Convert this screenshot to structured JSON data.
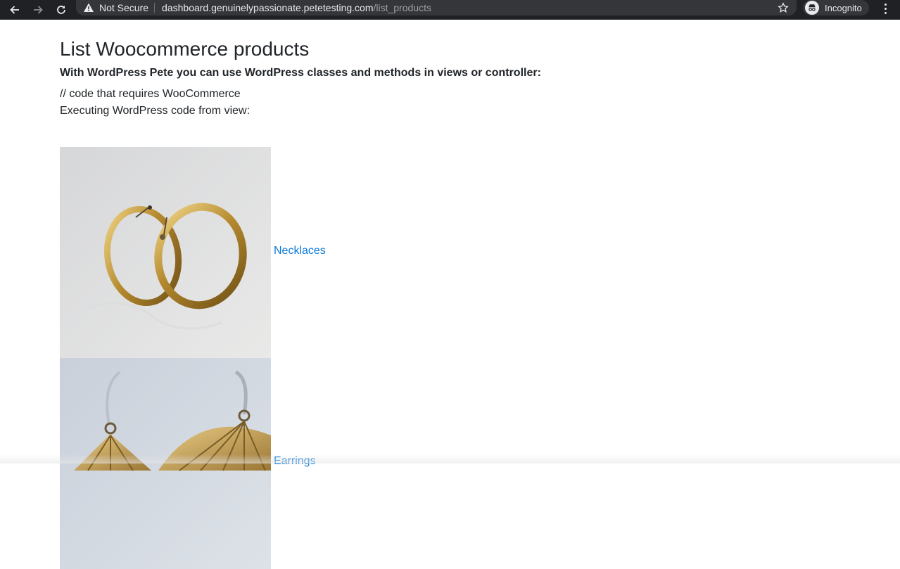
{
  "browser": {
    "security_label": "Not Secure",
    "url_host": "dashboard.genuinelypassionate.petetesting.com",
    "url_path": "/list_products",
    "profile_label": "Incognito"
  },
  "page": {
    "title": "List Woocommerce products",
    "subtitle": "With WordPress Pete you can use WordPress classes and methods in views or controller:",
    "code_comment": "// code that requires WooCommerce",
    "executing_note": "Executing WordPress code from view:"
  },
  "products": [
    {
      "category": "Necklaces",
      "image": "gold-hoop-earrings-photo"
    },
    {
      "category": "Earrings",
      "image": "gold-fan-earrings-photo"
    }
  ],
  "colors": {
    "link": "#0b79d8",
    "chrome_bg": "#202124",
    "omnibox_bg": "#35363a"
  }
}
